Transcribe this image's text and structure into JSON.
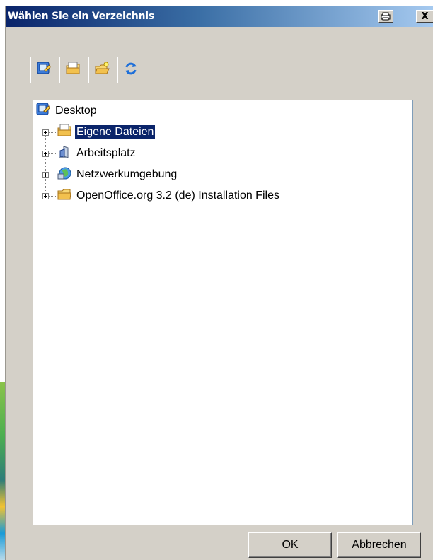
{
  "window": {
    "title": "Wählen Sie ein Verzeichnis"
  },
  "titlebar_buttons": [
    {
      "name": "print-icon"
    },
    {
      "name": "close-icon",
      "glyph": "X"
    }
  ],
  "toolbar": {
    "buttons": [
      {
        "name": "desktop-icon"
      },
      {
        "name": "my-documents-icon"
      },
      {
        "name": "new-folder-icon"
      },
      {
        "name": "refresh-icon"
      }
    ]
  },
  "tree": {
    "root": {
      "label": "Desktop",
      "icon": "desktop-icon"
    },
    "items": [
      {
        "label": "Eigene Dateien",
        "icon": "my-documents-icon",
        "selected": true
      },
      {
        "label": "Arbeitsplatz",
        "icon": "computer-icon",
        "selected": false
      },
      {
        "label": "Netzwerkumgebung",
        "icon": "network-icon",
        "selected": false
      },
      {
        "label": "OpenOffice.org 3.2 (de) Installation Files",
        "icon": "folder-icon",
        "selected": false
      }
    ]
  },
  "buttons": {
    "ok": "OK",
    "cancel": "Abbrechen"
  },
  "colors": {
    "titlebar_start": "#0a246a",
    "titlebar_end": "#a6caf0",
    "dialog_bg": "#d4d0c8",
    "selection": "#0a246a"
  }
}
